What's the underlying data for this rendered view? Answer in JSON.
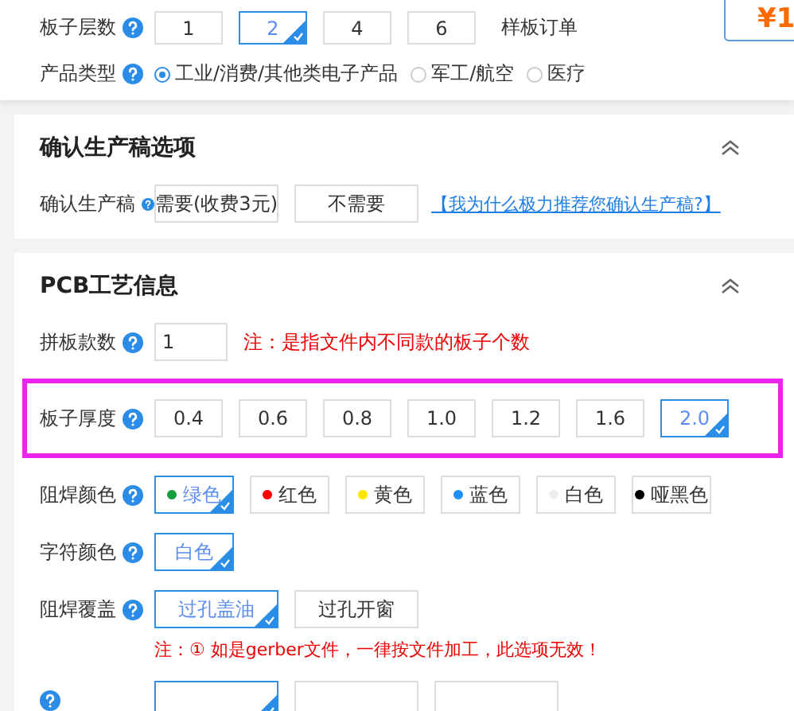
{
  "sections": [
    {
      "rows": [
        {
          "kind": "layer-options",
          "label": "板子层数",
          "help": true,
          "options": [
            {
              "text": "1",
              "selected": false
            },
            {
              "text": "2",
              "selected": true
            },
            {
              "text": "4",
              "selected": false
            },
            {
              "text": "6",
              "selected": false
            }
          ],
          "aside": "样板订单"
        },
        {
          "kind": "radio",
          "label": "产品类型",
          "help": true,
          "options": [
            {
              "text": "工业/消费/其他类电子产品",
              "selected": true
            },
            {
              "text": "军工/航空",
              "selected": false
            },
            {
              "text": "医疗",
              "selected": false
            }
          ]
        }
      ],
      "price": "¥1"
    },
    {
      "title": "确认生产稿选项",
      "expanded": true,
      "rows": [
        {
          "kind": "wide-options",
          "label": "确认生产稿",
          "help": true,
          "options": [
            {
              "text": "需要(收费3元)",
              "selected": false
            },
            {
              "text": "不需要",
              "selected": false
            }
          ],
          "link": "【我为什么极力推荐您确认生产稿?】"
        }
      ]
    },
    {
      "title": "PCB工艺信息",
      "expanded": true,
      "rows": [
        {
          "kind": "input",
          "label": "拼板款数",
          "help": true,
          "value": "1",
          "note": "注：是指文件内不同款的板子个数"
        },
        {
          "kind": "thickness-options",
          "label": "板子厚度",
          "help": true,
          "highlighted": true,
          "options": [
            {
              "text": "0.4",
              "selected": false
            },
            {
              "text": "0.6",
              "selected": false
            },
            {
              "text": "0.8",
              "selected": false
            },
            {
              "text": "1.0",
              "selected": false
            },
            {
              "text": "1.2",
              "selected": false
            },
            {
              "text": "1.6",
              "selected": false
            },
            {
              "text": "2.0",
              "selected": true
            }
          ]
        },
        {
          "kind": "color-options",
          "label": "阻焊颜色",
          "help": true,
          "options": [
            {
              "text": "绿色",
              "selected": true,
              "color": "#13a03c"
            },
            {
              "text": "红色",
              "selected": false,
              "color": "#ff0000"
            },
            {
              "text": "黄色",
              "selected": false,
              "color": "#ffe800"
            },
            {
              "text": "蓝色",
              "selected": false,
              "color": "#1e90ff"
            },
            {
              "text": "白色",
              "selected": false,
              "color": "#eeeeee"
            },
            {
              "text": "哑黑色",
              "selected": false,
              "color": "#000000"
            }
          ]
        },
        {
          "kind": "color-options",
          "label": "字符颜色",
          "help": true,
          "options": [
            {
              "text": "白色",
              "selected": true
            }
          ]
        },
        {
          "kind": "wide-options",
          "label": "阻焊覆盖",
          "help": true,
          "options": [
            {
              "text": "过孔盖油",
              "selected": true
            },
            {
              "text": "过孔开窗",
              "selected": false
            }
          ],
          "note": "注：① 如是gerber文件，一律按文件加工，此选项无效！"
        },
        {
          "kind": "cut",
          "help": true,
          "options": [
            {
              "selected": true
            },
            {
              "selected": false
            },
            {
              "selected": false
            }
          ]
        }
      ]
    }
  ]
}
